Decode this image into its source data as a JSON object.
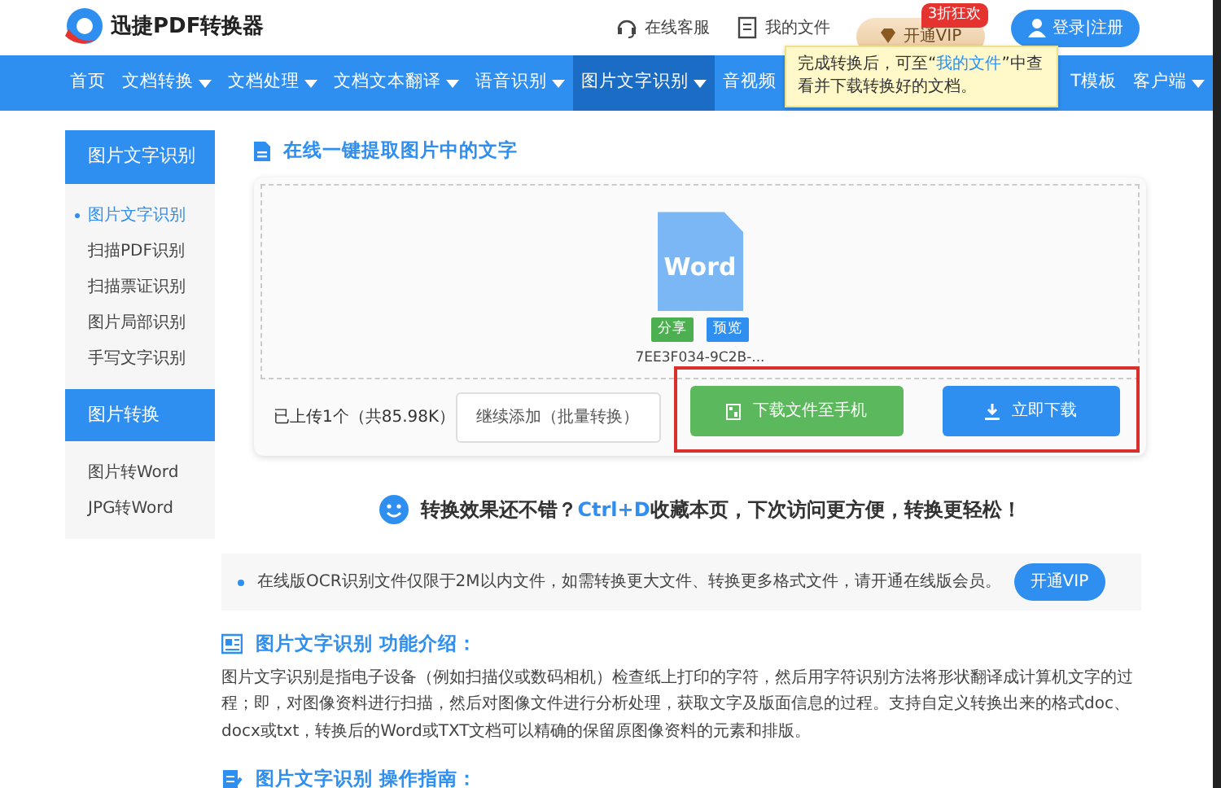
{
  "header": {
    "logo_text": "迅捷PDF转换器",
    "links": [
      {
        "label": "在线客服"
      },
      {
        "label": "我的文件"
      }
    ],
    "vip_button": {
      "label": "开通VIP",
      "badge": "3折狂欢"
    },
    "login_button": "登录|注册"
  },
  "tooltip": {
    "before": "完成转换后，可至“",
    "link": "我的文件",
    "after": "”中查看并下载转换好的文档。"
  },
  "nav": [
    {
      "label": "首页",
      "dropdown": false,
      "selected": false
    },
    {
      "label": "文档转换",
      "dropdown": true,
      "selected": false
    },
    {
      "label": "文档处理",
      "dropdown": true,
      "selected": false
    },
    {
      "label": "文档文本翻译",
      "dropdown": true,
      "selected": false
    },
    {
      "label": "语音识别",
      "dropdown": true,
      "selected": false
    },
    {
      "label": "图片文字识别",
      "dropdown": true,
      "selected": true
    },
    {
      "label": "音视频",
      "dropdown": false,
      "selected": false
    },
    {
      "label": "T模板",
      "dropdown": false,
      "selected": false
    },
    {
      "label": "客户端",
      "dropdown": true,
      "selected": false
    }
  ],
  "sidebar": [
    {
      "title": "图片文字识别",
      "items": [
        {
          "label": "图片文字识别",
          "selected": true
        },
        {
          "label": "扫描PDF识别",
          "selected": false
        },
        {
          "label": "扫描票证识别",
          "selected": false
        },
        {
          "label": "图片局部识别",
          "selected": false
        },
        {
          "label": "手写文字识别",
          "selected": false
        }
      ]
    },
    {
      "title": "图片转换",
      "items": [
        {
          "label": "图片转Word",
          "selected": false
        },
        {
          "label": "JPG转Word",
          "selected": false
        }
      ]
    }
  ],
  "main": {
    "title": "在线一键提取图片中的文字",
    "file": {
      "type_label": "Word",
      "share": "分享",
      "preview": "预览",
      "name": "7EE3F034-9C2B-..."
    },
    "upload_status": "已上传1个（共85.98K）",
    "buttons": [
      {
        "label": "继续添加（批量转换）",
        "kind": "outline",
        "highlighted": false
      },
      {
        "label": "下载文件至手机",
        "kind": "phone",
        "highlighted": true
      },
      {
        "label": "立即下载",
        "kind": "download",
        "highlighted": true
      }
    ]
  },
  "bookmark_tip": {
    "before": "转换效果还不错？",
    "shortcut": "Ctrl+D",
    "after": "收藏本页，下次访问更方便，转换更轻松！"
  },
  "notice": {
    "text": "在线版OCR识别文件仅限于2M以内文件，如需转换更大文件、转换更多格式文件，请开通在线版会员。",
    "button": "开通VIP"
  },
  "sections": [
    {
      "kind": "intro",
      "title": "图片文字识别 功能介绍：",
      "body": "图片文字识别是指电子设备（例如扫描仪或数码相机）检查纸上打印的字符，然后用字符识别方法将形状翻译成计算机文字的过程；即，对图像资料进行扫描，然后对图像文件进行分析处理，获取文字及版面信息的过程。支持自定义转换出来的格式doc、docx或txt，转换后的Word或TXT文档可以精确的保留原图像资料的元素和排版。"
    },
    {
      "kind": "guide",
      "title": "图片文字识别 操作指南："
    }
  ]
}
